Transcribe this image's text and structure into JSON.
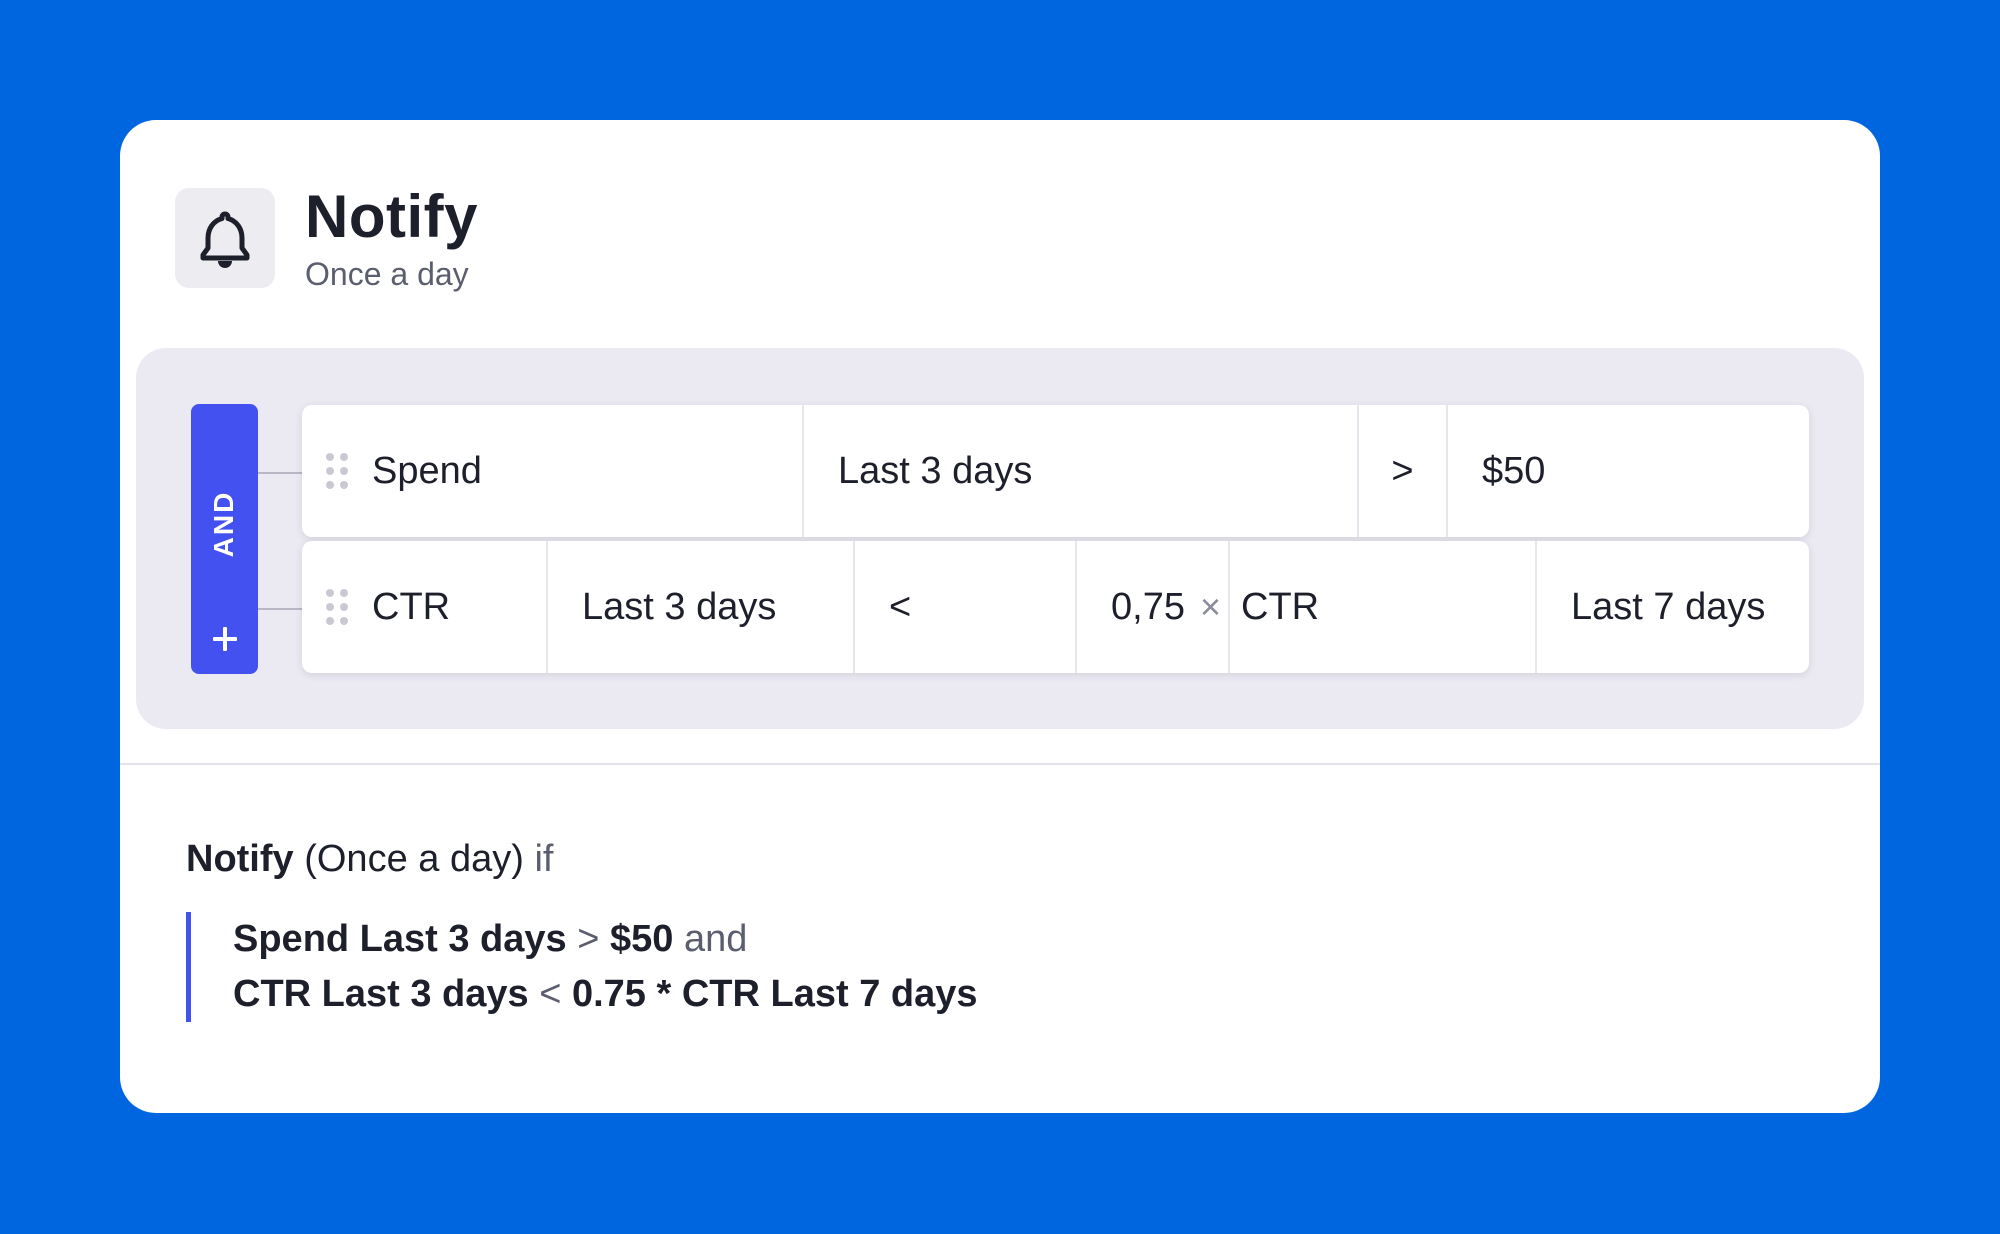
{
  "header": {
    "title": "Notify",
    "subtitle": "Once a day",
    "icon": "bell-icon"
  },
  "builder": {
    "operator_label": "AND",
    "add_icon": "plus-icon",
    "rows": [
      {
        "metric": "Spend",
        "period": "Last 3 days",
        "comparator": ">",
        "value": "$50"
      },
      {
        "metric": "CTR",
        "period": "Last 3 days",
        "comparator": "<",
        "multiplier": "0,75",
        "times": "×",
        "compare_metric": "CTR",
        "compare_period": "Last 7 days"
      }
    ]
  },
  "summary": {
    "action": "Notify",
    "frequency": "(Once a day)",
    "if_word": "if",
    "line1": {
      "metric": "Spend Last 3 days",
      "comparator": ">",
      "value": "$50",
      "conj": "and"
    },
    "line2": {
      "metric": "CTR Last 3 days",
      "comparator": "<",
      "expr": "0.75 * CTR Last 7 days"
    }
  },
  "colors": {
    "background": "#0066e0",
    "accent": "#4451f1",
    "panel": "#ebeaf2"
  }
}
